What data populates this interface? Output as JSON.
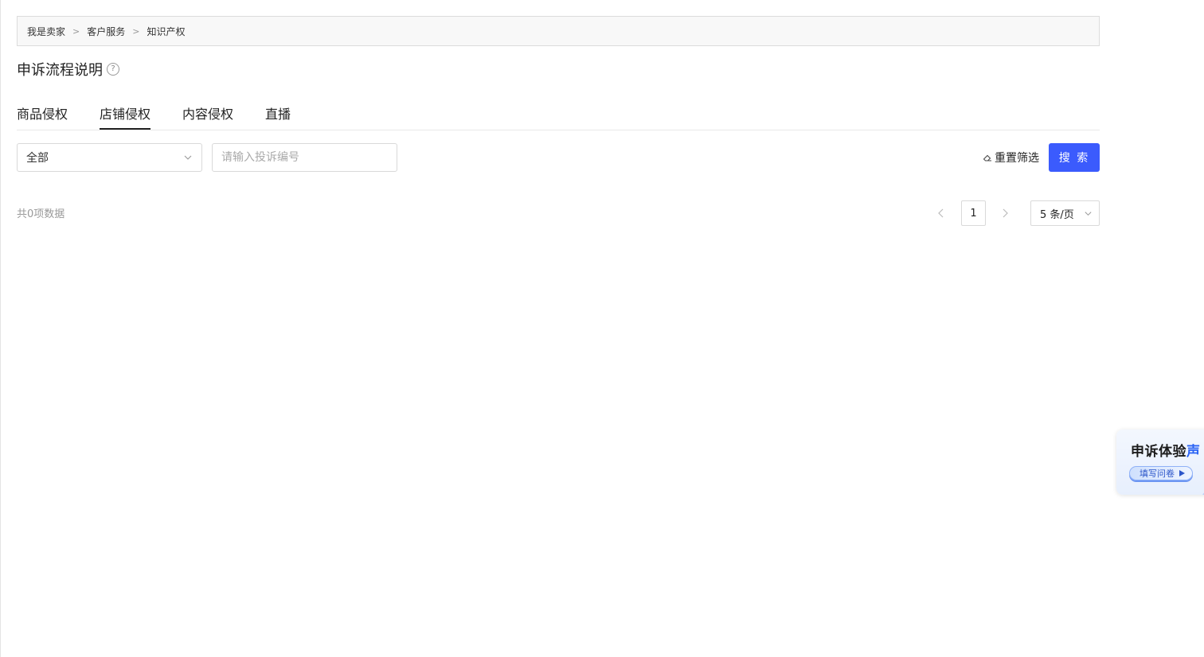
{
  "breadcrumb": {
    "items": [
      "我是卖家",
      "客户服务",
      "知识产权"
    ],
    "separator": ">"
  },
  "page": {
    "title": "申诉流程说明",
    "help_icon_glyph": "?"
  },
  "tabs": [
    {
      "label": "商品侵权",
      "active": false
    },
    {
      "label": "店铺侵权",
      "active": true
    },
    {
      "label": "内容侵权",
      "active": false
    },
    {
      "label": "直播",
      "active": false
    }
  ],
  "filters": {
    "status_select_value": "全部",
    "complaint_id_placeholder": "请输入投诉编号",
    "complaint_id_value": "",
    "reset_label": "重置筛选",
    "search_label": "搜 索"
  },
  "list": {
    "total_text": "共0项数据"
  },
  "pagination": {
    "current_page": "1",
    "page_size_label": "5 条/页"
  },
  "survey_widget": {
    "title_main": "申诉体验",
    "title_accent": "声",
    "button_label": "填写问卷"
  },
  "colors": {
    "primary": "#3b5bfd",
    "survey_accent": "#2a63f5",
    "muted_text": "#999999",
    "border": "#d9d9d9"
  },
  "icons": {
    "help": "question-circle-icon",
    "select_chevron": "chevron-down-icon",
    "reset": "eraser-icon",
    "prev": "chevron-left-icon",
    "next": "chevron-right-icon",
    "play": "play-triangle-icon"
  }
}
